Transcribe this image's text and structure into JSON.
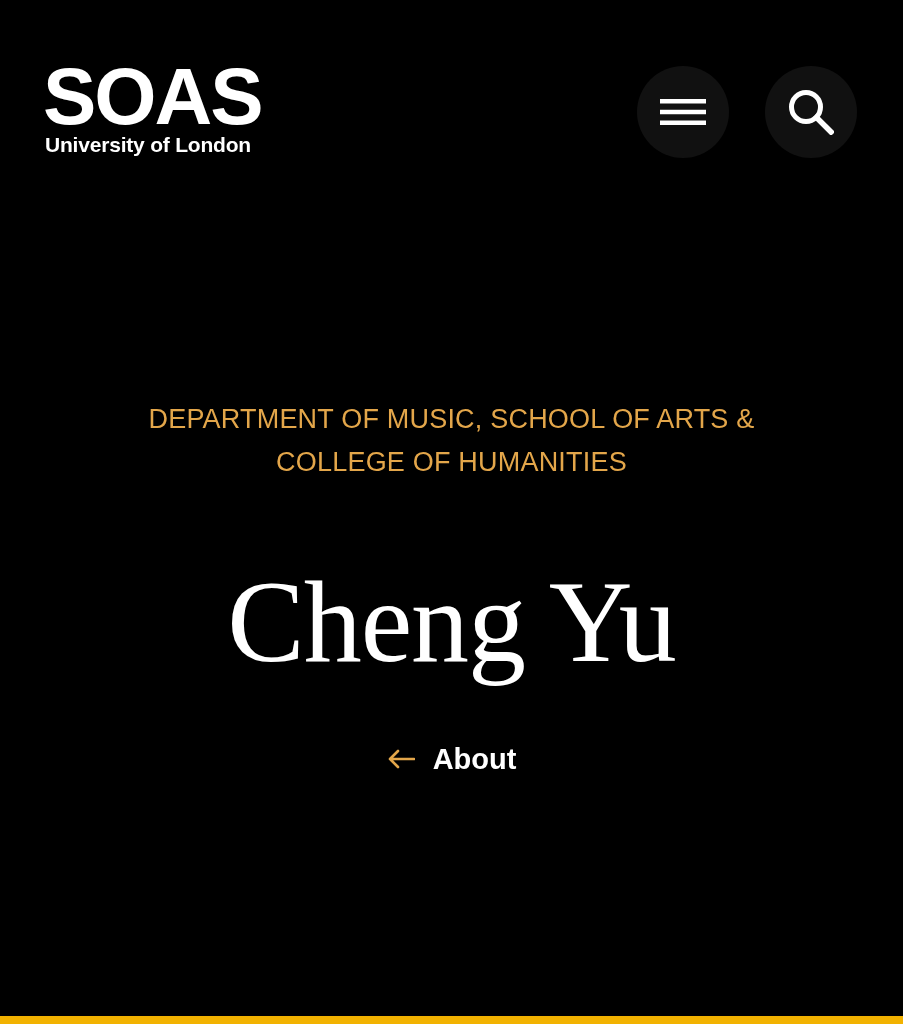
{
  "header": {
    "logo": {
      "wordmark": "SOAS",
      "tagline": "University of London"
    }
  },
  "hero": {
    "department": "DEPARTMENT OF MUSIC, SCHOOL OF ARTS & COLLEGE OF HUMANITIES",
    "name": "Cheng Yu",
    "back_link": {
      "label": "About"
    }
  }
}
